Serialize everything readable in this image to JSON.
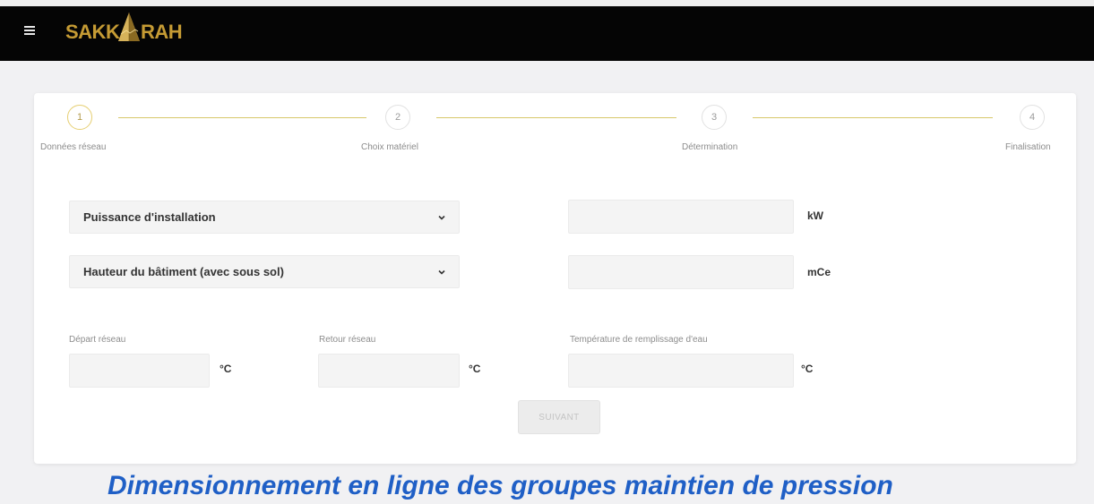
{
  "header": {
    "logo_left": "SAKK",
    "logo_right": "RAH",
    "menu_icon": "hamburger-icon",
    "bg_color": "#050505",
    "logo_color": "#c59b34"
  },
  "stepper": {
    "steps": [
      {
        "number": "1",
        "label": "Données réseau"
      },
      {
        "number": "2",
        "label": "Choix matériel"
      },
      {
        "number": "3",
        "label": "Détermination"
      },
      {
        "number": "4",
        "label": "Finalisation"
      }
    ],
    "line_color": "#d8c86a"
  },
  "form": {
    "select_power": "Puissance d'installation",
    "select_height": "Hauteur du bâtiment (avec sous sol)",
    "unit_power": "kW",
    "unit_height": "mCe",
    "depart_label": "Départ réseau",
    "retour_label": "Retour réseau",
    "temp_label": "Température de remplissage d'eau",
    "unit_celsius": "°C",
    "next_button": "SUIVANT"
  },
  "footer": {
    "title": "Dimensionnement en ligne des groupes maintien de pression",
    "color": "#1f5fc6"
  }
}
